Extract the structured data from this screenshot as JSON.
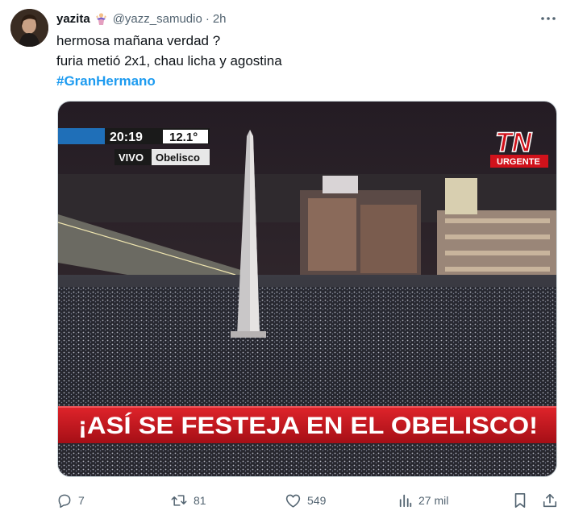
{
  "tweet": {
    "display_name": "yazita",
    "handle": "@yazz_samudio",
    "separator": "·",
    "time": "2h",
    "text_line_1": "hermosa mañana verdad ?",
    "text_line_2": "furia metió 2x1, chau licha y agostina",
    "hashtag": "#GranHermano"
  },
  "media": {
    "clock": "20:19",
    "temperature": "12.1°",
    "live_label": "VIVO",
    "location_label": "Obelisco",
    "channel_logo": "TN",
    "channel_tag": "URGENTE",
    "headline": "¡ASÍ SE FESTEJA EN EL OBELISCO!"
  },
  "actions": {
    "replies": "7",
    "retweets": "81",
    "likes": "549",
    "views": "27 mil"
  },
  "colors": {
    "accent": "#1d9bf0",
    "secondary_text": "#536471",
    "tn_red": "#d0121b",
    "banner_red": "#c4161c"
  },
  "icons": [
    "more-icon",
    "reply-icon",
    "retweet-icon",
    "like-icon",
    "views-icon",
    "bookmark-icon",
    "share-icon"
  ]
}
